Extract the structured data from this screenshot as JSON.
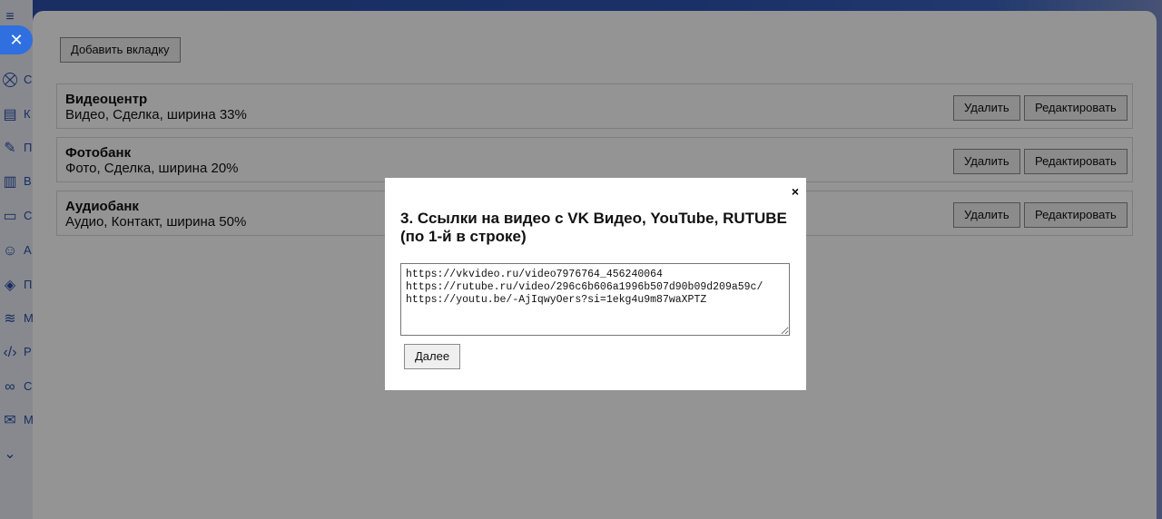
{
  "background": {
    "sidebar": {
      "close_icon": "close-icon",
      "letters": [
        "С",
        "К",
        "П",
        "В",
        "С",
        "А",
        "П",
        "М",
        "Р",
        "С",
        "М"
      ]
    },
    "panel": {
      "add_tab_label": "Добавить вкладку",
      "tabs": [
        {
          "title": "Видеоцентр",
          "desc": "Видео, Сделка, ширина 33%",
          "delete_label": "Удалить",
          "edit_label": "Редактировать"
        },
        {
          "title": "Фотобанк",
          "desc": "Фото, Сделка, ширина 20%",
          "delete_label": "Удалить",
          "edit_label": "Редактировать"
        },
        {
          "title": "Аудиобанк",
          "desc": "Аудио, Контакт, ширина 50%",
          "delete_label": "Удалить",
          "edit_label": "Редактировать"
        }
      ]
    }
  },
  "modal": {
    "close_glyph": "×",
    "title": "3. Ссылки на видео с VK Видео, YouTube, RUTUBE (по 1-й в строке)",
    "textarea_value": "https://vkvideo.ru/video7976764_456240064\nhttps://rutube.ru/video/296c6b606a1996b507d90b09d209a59c/\nhttps://youtu.be/-AjIqwyOers?si=1ekg4u9m87waXPTZ",
    "next_label": "Далее"
  },
  "colors": {
    "accent": "#2f6fe0",
    "overlay": "rgba(0,0,0,0.42)"
  }
}
